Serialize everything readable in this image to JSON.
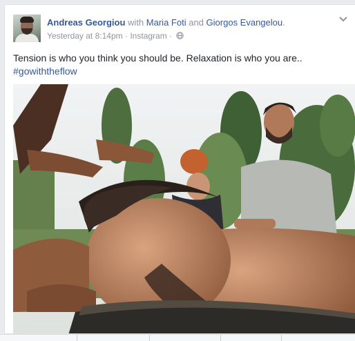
{
  "post": {
    "author": "Andreas Georgiou",
    "with_word": "with",
    "tagged_1": "Maria Foti",
    "and_word": "and",
    "tagged_2": "Giorgos Evangelou",
    "tail": ".",
    "timestamp": "Yesterday at 8:14pm",
    "separator": "·",
    "source": "Instagram",
    "privacy_icon": "globe-icon",
    "options_icon": "chevron-down-icon",
    "text": "Tension is who you think you should be. Relaxation is who you are..",
    "hashtag": "#gowiththeflow"
  },
  "colors": {
    "link": "#365899",
    "meta": "#90949c",
    "text": "#1d2129",
    "card_bg": "#ffffff",
    "page_bg": "#e9ebee"
  }
}
